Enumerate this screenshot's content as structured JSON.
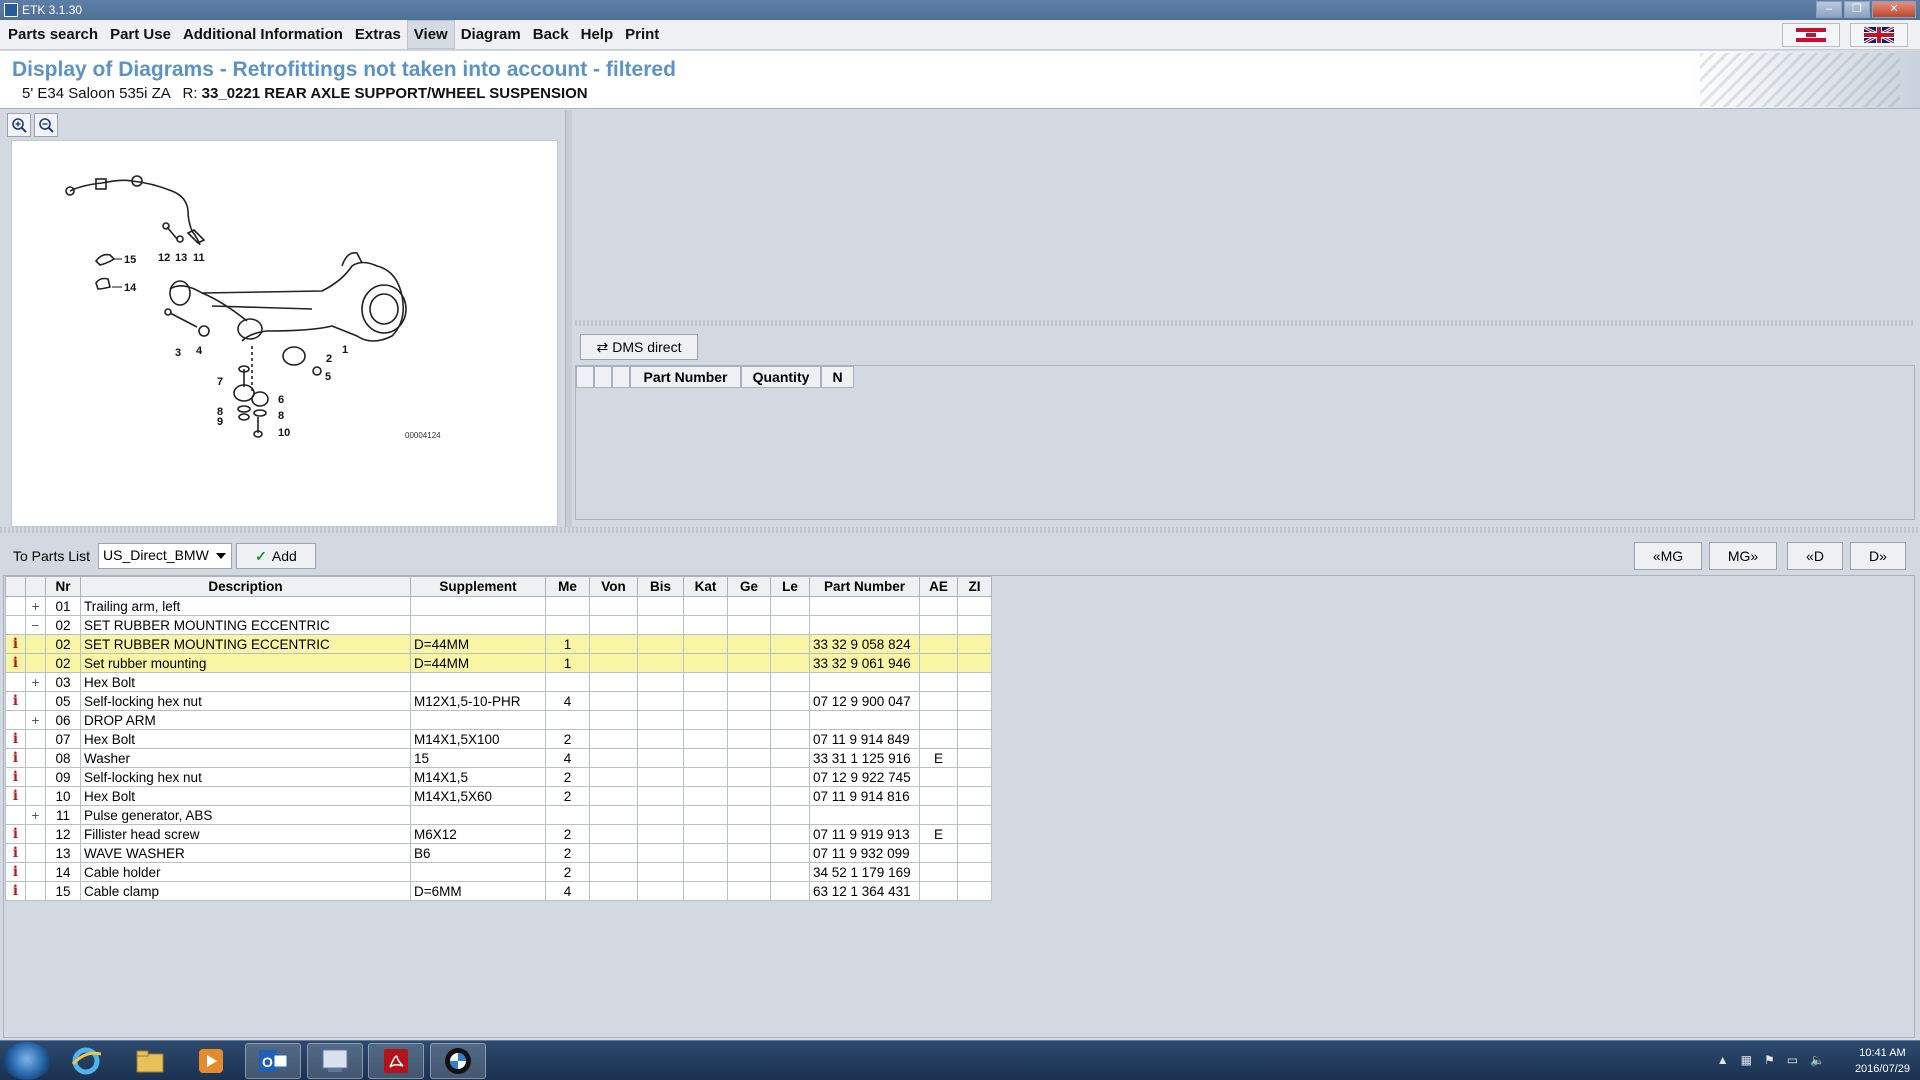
{
  "window": {
    "title": "ETK 3.1.30"
  },
  "menu": {
    "items": [
      "Parts search",
      "Part Use",
      "Additional Information",
      "Extras",
      "View",
      "Diagram",
      "Back",
      "Help",
      "Print"
    ],
    "active": "View"
  },
  "header": {
    "title": "Display of Diagrams - Retrofittings not taken into account - filtered",
    "vehicle": "5' E34 Saloon 535i ZA",
    "r_label": "R:",
    "group": "33_0221 REAR AXLE SUPPORT/WHEEL SUSPENSION"
  },
  "diagram": {
    "image_id": "00004124",
    "callouts": [
      "15",
      "14",
      "12",
      "13",
      "11",
      "3",
      "4",
      "2",
      "1",
      "5",
      "7",
      "6",
      "8",
      "9",
      "8",
      "10"
    ]
  },
  "dms": {
    "button_label": "DMS direct",
    "columns": [
      "",
      "",
      "",
      "Part Number",
      "Quantity",
      "N"
    ]
  },
  "toolbar": {
    "to_parts_label": "To Parts List",
    "parts_list_value": "US_Direct_BMW",
    "add_label": "Add",
    "nav": [
      "«MG",
      "MG»",
      "«D",
      "D»"
    ]
  },
  "parts": {
    "columns": [
      "",
      "",
      "Nr",
      "Description",
      "Supplement",
      "Me",
      "Von",
      "Bis",
      "Kat",
      "Ge",
      "Le",
      "Part Number",
      "AE",
      "ZI"
    ],
    "rows": [
      {
        "info": "",
        "exp": "+",
        "nr": "01",
        "desc": "Trailing arm, left",
        "sup": "",
        "me": "",
        "pn": "",
        "ae": "",
        "hl": false
      },
      {
        "info": "",
        "exp": "−",
        "nr": "02",
        "desc": "SET RUBBER MOUNTING ECCENTRIC",
        "sup": "",
        "me": "",
        "pn": "",
        "ae": "",
        "hl": false
      },
      {
        "info": "i",
        "exp": "",
        "nr": "02",
        "desc": "SET RUBBER MOUNTING ECCENTRIC",
        "sup": "D=44MM",
        "me": "1",
        "pn": "33 32 9 058 824",
        "ae": "",
        "hl": true
      },
      {
        "info": "i",
        "exp": "",
        "nr": "02",
        "desc": "Set rubber mounting",
        "sup": "D=44MM",
        "me": "1",
        "pn": "33 32 9 061 946",
        "ae": "",
        "hl": true
      },
      {
        "info": "",
        "exp": "+",
        "nr": "03",
        "desc": "Hex Bolt",
        "sup": "",
        "me": "",
        "pn": "",
        "ae": "",
        "hl": false
      },
      {
        "info": "i",
        "exp": "",
        "nr": "05",
        "desc": "Self-locking hex nut",
        "sup": "M12X1,5-10-PHR",
        "me": "4",
        "pn": "07 12 9 900 047",
        "ae": "",
        "hl": false
      },
      {
        "info": "",
        "exp": "+",
        "nr": "06",
        "desc": "DROP ARM",
        "sup": "",
        "me": "",
        "pn": "",
        "ae": "",
        "hl": false
      },
      {
        "info": "i",
        "exp": "",
        "nr": "07",
        "desc": "Hex Bolt",
        "sup": "M14X1,5X100",
        "me": "2",
        "pn": "07 11 9 914 849",
        "ae": "",
        "hl": false
      },
      {
        "info": "i",
        "exp": "",
        "nr": "08",
        "desc": "Washer",
        "sup": "15",
        "me": "4",
        "pn": "33 31 1 125 916",
        "ae": "E",
        "hl": false
      },
      {
        "info": "i",
        "exp": "",
        "nr": "09",
        "desc": "Self-locking hex nut",
        "sup": "M14X1,5",
        "me": "2",
        "pn": "07 12 9 922 745",
        "ae": "",
        "hl": false
      },
      {
        "info": "i",
        "exp": "",
        "nr": "10",
        "desc": "Hex Bolt",
        "sup": "M14X1,5X60",
        "me": "2",
        "pn": "07 11 9 914 816",
        "ae": "",
        "hl": false
      },
      {
        "info": "",
        "exp": "+",
        "nr": "11",
        "desc": "Pulse generator, ABS",
        "sup": "",
        "me": "",
        "pn": "",
        "ae": "",
        "hl": false
      },
      {
        "info": "i",
        "exp": "",
        "nr": "12",
        "desc": "Fillister head screw",
        "sup": "M6X12",
        "me": "2",
        "pn": "07 11 9 919 913",
        "ae": "E",
        "hl": false
      },
      {
        "info": "i",
        "exp": "",
        "nr": "13",
        "desc": "WAVE WASHER",
        "sup": "B6",
        "me": "2",
        "pn": "07 11 9 932 099",
        "ae": "",
        "hl": false
      },
      {
        "info": "i",
        "exp": "",
        "nr": "14",
        "desc": "Cable holder",
        "sup": "",
        "me": "2",
        "pn": "34 52 1 179 169",
        "ae": "",
        "hl": false
      },
      {
        "info": "i",
        "exp": "",
        "nr": "15",
        "desc": "Cable clamp",
        "sup": "D=6MM",
        "me": "4",
        "pn": "63 12 1 364 431",
        "ae": "",
        "hl": false
      }
    ]
  },
  "taskbar": {
    "time": "10:41 AM",
    "date": "2016/07/29",
    "apps": [
      "ie-icon",
      "explorer-icon",
      "media-player-icon",
      "outlook-icon",
      "etk-icon",
      "acrobat-icon",
      "bmw-icon"
    ]
  }
}
